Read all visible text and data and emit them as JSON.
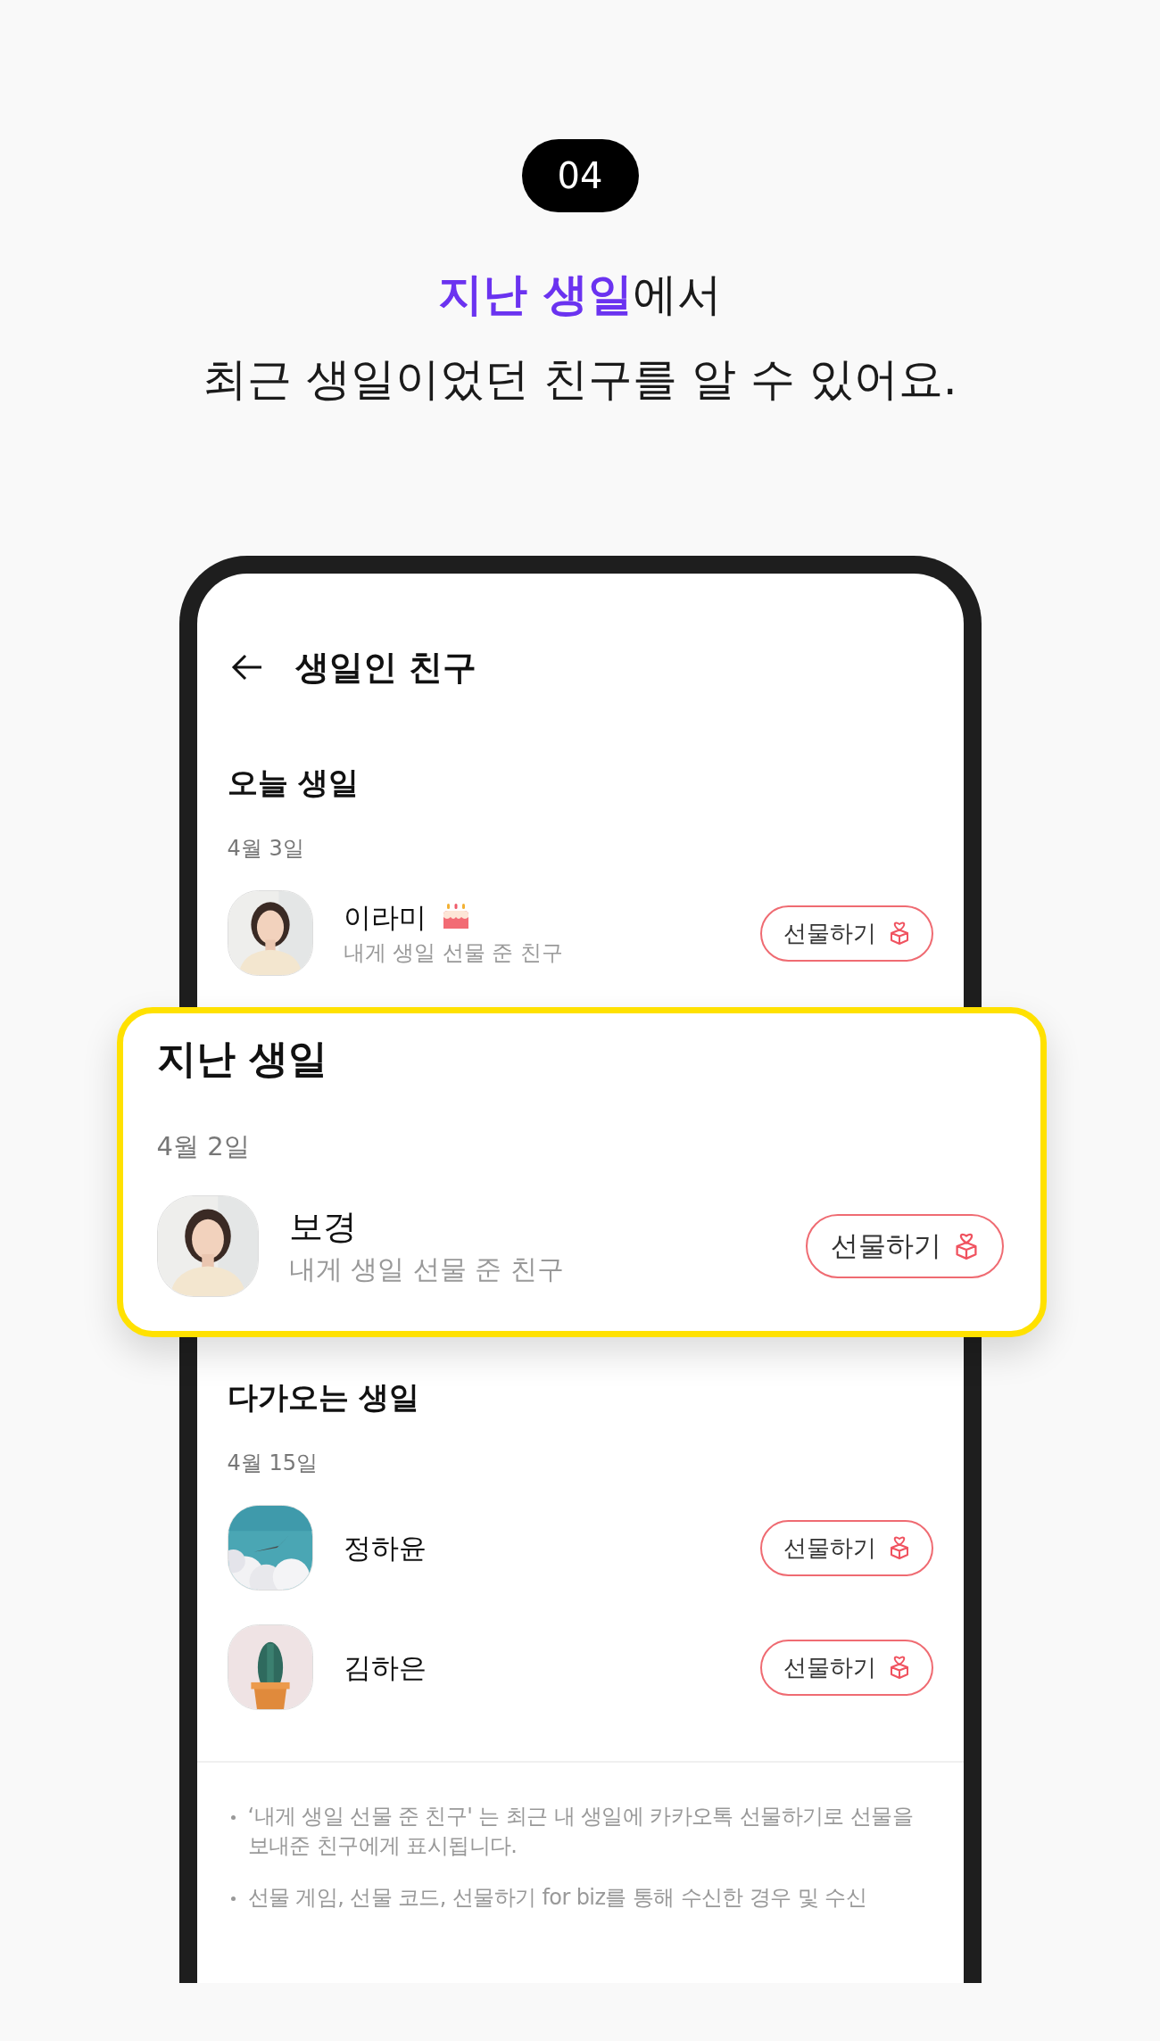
{
  "badge": "04",
  "headline": "**지난 생일**에서\n최근 생일이었던 친구를 알 수 있어요.",
  "screen": {
    "title": "생일인 친구",
    "sections": [
      {
        "heading": "오늘 생일",
        "highlighted": false,
        "date": "4월 3일",
        "friends": [
          {
            "name": "이라미",
            "cake": true,
            "note": "내게 생일 선물 준 친구",
            "button": "선물하기"
          }
        ]
      },
      {
        "heading": "지난 생일",
        "highlighted": true,
        "date": "4월 2일",
        "friends": [
          {
            "name": "보경",
            "cake": false,
            "note": "내게 생일 선물 준 친구",
            "button": "선물하기"
          }
        ]
      },
      {
        "heading": "다가오는 생일",
        "highlighted": false,
        "date": "4월 15일",
        "friends": [
          {
            "name": "정하윤",
            "cake": false,
            "button": "선물하기"
          },
          {
            "name": "김하은",
            "cake": false,
            "button": "선물하기"
          }
        ]
      }
    ],
    "notes": [
      "‘내게 생일 선물 준 친구' 는 최근 내 생일에 카카오톡 선물하기로 선물을 보내준 친구에게 표시됩니다.",
      "선물 게임, 선물 코드, 선물하기 for biz를 통해 수신한 경우 및 수신"
    ]
  }
}
